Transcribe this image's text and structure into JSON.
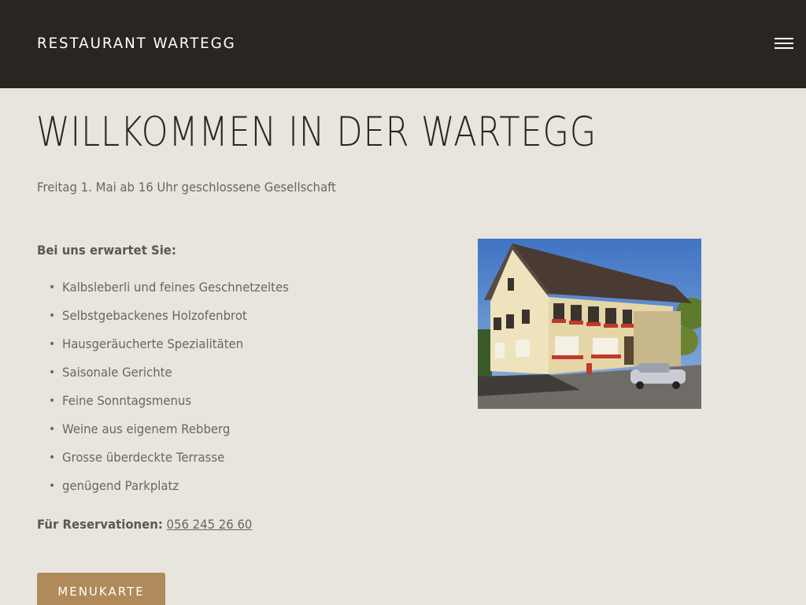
{
  "header": {
    "brand": "RESTAURANT WARTEGG",
    "menu_icon": "hamburger-menu-icon"
  },
  "main": {
    "title": "WILLKOMMEN IN DER WARTEGG",
    "notice": "Freitag 1. Mai ab 16 Uhr geschlossene Gesellschaft",
    "lead": "Bei uns erwartet Sie:",
    "features": [
      "Kalbsleberli und feines Geschnetzeltes",
      "Selbstgebackenes Holzofenbrot",
      "Hausgeräucherte Spezialitäten",
      "Saisonale Gerichte",
      "Feine Sonntagsmenus",
      "Weine aus eigenem Rebberg",
      "Grosse überdeckte Terrasse",
      "genügend Parkplatz"
    ],
    "reservation_label": "Für Reservationen:",
    "reservation_phone": "056 245 26 60",
    "menu_button": "MENUKARTE"
  },
  "colors": {
    "header_bg": "#292622",
    "page_bg": "#e8e5df",
    "accent": "#b08a5a"
  }
}
